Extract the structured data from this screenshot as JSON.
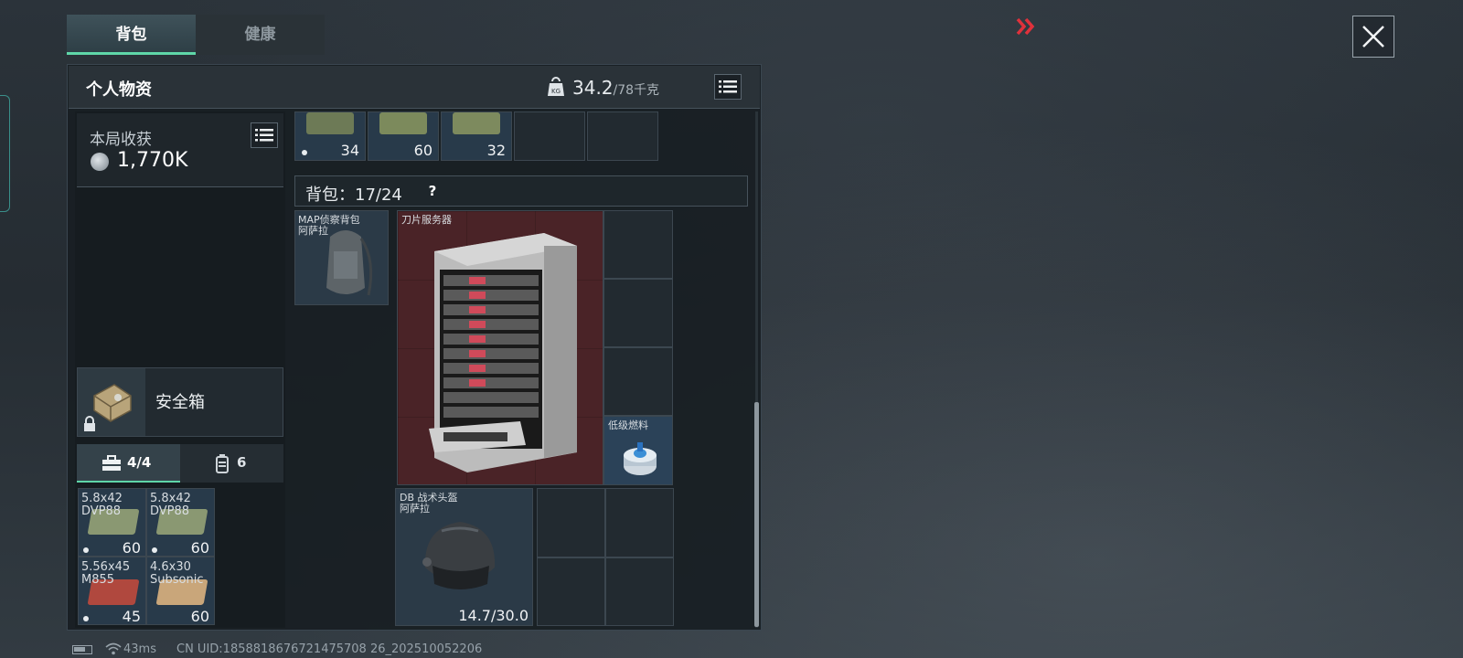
{
  "tabs": [
    {
      "label": "背包",
      "active": true
    },
    {
      "label": "健康",
      "active": false
    }
  ],
  "header": {
    "title": "个人物资",
    "weight_current": "34.2",
    "weight_max": "/78千克"
  },
  "harvest": {
    "label": "本局收获",
    "value": "1,770K"
  },
  "safe_box": {
    "label": "安全箱"
  },
  "pouch_tabs": [
    {
      "label": "4/4",
      "icon": "toolbox-icon",
      "active": true
    },
    {
      "label": "6",
      "icon": "canister-icon",
      "active": false
    }
  ],
  "pouch_items": [
    {
      "name": "5.8x42\nDVP88",
      "count": "60",
      "color": "#8a9872"
    },
    {
      "name": "5.8x42\nDVP88",
      "count": "60",
      "color": "#8a9872"
    },
    {
      "name": "5.56x45\nM855",
      "count": "45",
      "color": "#b0483e"
    },
    {
      "name": "4.6x30\nSubsonic",
      "count": "60",
      "color": "#c9a67a"
    }
  ],
  "top_row_items": [
    {
      "count": "34",
      "color": "#6d7a56",
      "dot": true
    },
    {
      "count": "60",
      "color": "#7c8a5c",
      "dot": false
    },
    {
      "count": "32",
      "color": "#7d8a5e",
      "dot": false
    }
  ],
  "backpack": {
    "label": "背包：",
    "capacity": "17/24",
    "help": "?"
  },
  "items": {
    "map_backpack": {
      "name": "MAP侦察背包\n阿萨拉"
    },
    "blade_server": {
      "name": "刀片服务器"
    },
    "low_fuel": {
      "name": "低级燃料"
    },
    "helmet": {
      "name": "DB 战术头盔\n阿萨拉",
      "durability": "14.7/30.0"
    }
  },
  "status_bar": {
    "ping": "43ms",
    "uid": "CN UID:1858818676721475708 26_202510052206"
  },
  "colors": {
    "accent_green": "#5fd6a8",
    "arrow_red": "#e0313b",
    "server_bg": "#4a2327"
  }
}
